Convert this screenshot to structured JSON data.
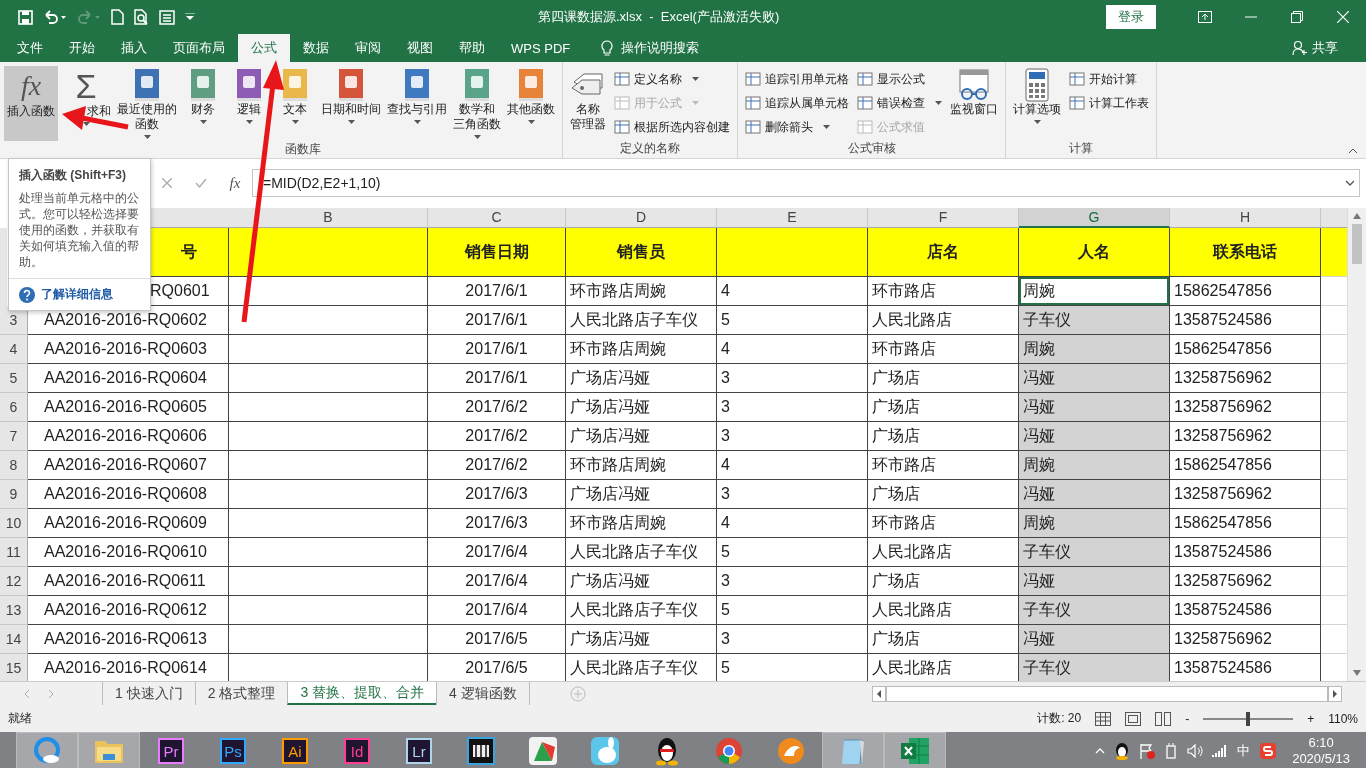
{
  "title_bar": {
    "quick_access": [
      {
        "kind": "save",
        "disabled": false
      },
      {
        "kind": "undo",
        "disabled": false
      },
      {
        "kind": "redo",
        "disabled": true
      },
      {
        "kind": "new",
        "disabled": false
      },
      {
        "kind": "preview",
        "disabled": false
      },
      {
        "kind": "form",
        "disabled": false
      },
      {
        "kind": "customize",
        "disabled": false
      }
    ],
    "title": "第四课数据源.xlsx  -  Excel(产品激活失败)",
    "login": "登录"
  },
  "tabs": [
    {
      "label": "文件",
      "selected": false
    },
    {
      "label": "开始",
      "selected": false
    },
    {
      "label": "插入",
      "selected": false
    },
    {
      "label": "页面布局",
      "selected": false
    },
    {
      "label": "公式",
      "selected": true
    },
    {
      "label": "数据",
      "selected": false
    },
    {
      "label": "审阅",
      "selected": false
    },
    {
      "label": "视图",
      "selected": false
    },
    {
      "label": "帮助",
      "selected": false
    },
    {
      "label": "WPS PDF",
      "selected": false
    }
  ],
  "tell_me": "操作说明搜索",
  "share": "共享",
  "ribbon": {
    "groups": [
      {
        "label": "函数库",
        "items": [
          {
            "kind": "fx",
            "icon_text": "fx",
            "lines": [
              "插入函数"
            ],
            "dropdown": false,
            "hovered": true,
            "partial": false
          },
          {
            "kind": "sigma",
            "icon_text": "Σ",
            "lines": [
              "求和"
            ],
            "dropdown": true,
            "hovered": false,
            "partial": true
          },
          {
            "kind": "book",
            "color": "#3d72b4",
            "lines": [
              "最近使用的",
              "函数"
            ],
            "dropdown": true,
            "hovered": false,
            "partial": false
          },
          {
            "kind": "book",
            "color": "#5f9e80",
            "lines": [
              "财务"
            ],
            "dropdown": true,
            "hovered": false,
            "partial": false
          },
          {
            "kind": "book",
            "color": "#8e5bb5",
            "lines": [
              "逻辑"
            ],
            "dropdown": true,
            "hovered": false,
            "partial": false
          },
          {
            "kind": "book",
            "color": "#eab84a",
            "lines": [
              "文本"
            ],
            "dropdown": true,
            "hovered": false,
            "partial": false
          },
          {
            "kind": "book",
            "color": "#d4553a",
            "lines": [
              "日期和时间"
            ],
            "dropdown": true,
            "hovered": false,
            "partial": false
          },
          {
            "kind": "book",
            "color": "#3f7ac0",
            "lines": [
              "查找与引用"
            ],
            "dropdown": true,
            "hovered": false,
            "partial": false
          },
          {
            "kind": "book",
            "color": "#5aa58a",
            "lines": [
              "数学和",
              "三角函数"
            ],
            "dropdown": true,
            "hovered": false,
            "partial": false
          },
          {
            "kind": "book",
            "color": "#e8833a",
            "lines": [
              "其他函数"
            ],
            "dropdown": true,
            "hovered": false,
            "partial": false
          }
        ]
      },
      {
        "label": "定义的名称",
        "items": [
          {
            "kind": "tags",
            "lines": [
              "名称",
              "管理器"
            ],
            "dropdown": false,
            "hovered": false,
            "partial": false
          },
          {
            "kind": "column",
            "items": [
              {
                "label": "定义名称",
                "dropdown": true,
                "disabled": false
              },
              {
                "label": "用于公式",
                "dropdown": true,
                "disabled": true
              },
              {
                "label": "根据所选内容创建",
                "dropdown": false,
                "disabled": false
              }
            ]
          }
        ]
      },
      {
        "label": "公式审核",
        "items": [
          {
            "kind": "column",
            "items": [
              {
                "label": "追踪引用单元格",
                "dropdown": false,
                "disabled": false
              },
              {
                "label": "追踪从属单元格",
                "dropdown": false,
                "disabled": false
              },
              {
                "label": "删除箭头",
                "dropdown": true,
                "disabled": false
              }
            ]
          },
          {
            "kind": "column",
            "items": [
              {
                "label": "显示公式",
                "dropdown": false,
                "disabled": false
              },
              {
                "label": "错误检查",
                "dropdown": true,
                "disabled": false
              },
              {
                "label": "公式求值",
                "dropdown": false,
                "disabled": true
              }
            ]
          },
          {
            "kind": "watch",
            "lines": [
              "监视窗口"
            ],
            "dropdown": false,
            "hovered": false,
            "partial": false
          }
        ]
      },
      {
        "label": "计算",
        "items": [
          {
            "kind": "calculator",
            "lines": [
              "计算选项"
            ],
            "dropdown": true,
            "hovered": false,
            "partial": false
          },
          {
            "kind": "column",
            "items": [
              {
                "label": "开始计算",
                "dropdown": false,
                "disabled": false
              },
              {
                "label": "计算工作表",
                "dropdown": false,
                "disabled": false
              }
            ]
          }
        ]
      }
    ]
  },
  "formula_bar": {
    "fx": "fx",
    "formula": "=MID(D2,E2+1,10)"
  },
  "tooltip": {
    "title": "插入函数 (Shift+F3)",
    "body": "处理当前单元格中的公式。您可以轻松选择要使用的函数，并获取有关如何填充输入值的帮助。",
    "link": "了解详细信息"
  },
  "grid": {
    "columns": [
      {
        "selected": false
      },
      {
        "label": "B",
        "selected": false
      },
      {
        "label": "C",
        "selected": false
      },
      {
        "label": "D",
        "selected": false
      },
      {
        "label": "E",
        "selected": false
      },
      {
        "label": "F",
        "selected": false
      },
      {
        "label": "G",
        "selected": true
      },
      {
        "label": "H",
        "selected": false
      }
    ],
    "rows": [
      {
        "kind": "header",
        "first_cell_partial": true,
        "has_active_cell": false,
        "cells": [
          "号",
          "",
          "销售日期",
          "销售员",
          "",
          "店名",
          "人名",
          "联系电话"
        ]
      },
      {
        "kind": "data",
        "first_cell_partial": true,
        "has_active_cell": true,
        "cells": [
          "RQ0601",
          "",
          "2017/6/1",
          "环市路店周婉",
          "4",
          "环市路店",
          "周婉",
          "15862547856"
        ]
      },
      {
        "kind": "data",
        "header": "3",
        "first_cell_partial": false,
        "has_active_cell": false,
        "cells": [
          "AA2016-2016-RQ0602",
          "",
          "2017/6/1",
          "人民北路店子车仪",
          "5",
          "人民北路店",
          "子车仪",
          "13587524586"
        ]
      },
      {
        "kind": "data",
        "header": "4",
        "first_cell_partial": false,
        "has_active_cell": false,
        "cells": [
          "AA2016-2016-RQ0603",
          "",
          "2017/6/1",
          "环市路店周婉",
          "4",
          "环市路店",
          "周婉",
          "15862547856"
        ]
      },
      {
        "kind": "data",
        "header": "5",
        "first_cell_partial": false,
        "has_active_cell": false,
        "cells": [
          "AA2016-2016-RQ0604",
          "",
          "2017/6/1",
          "广场店冯娅",
          "3",
          "广场店",
          "冯娅",
          "13258756962"
        ]
      },
      {
        "kind": "data",
        "header": "6",
        "first_cell_partial": false,
        "has_active_cell": false,
        "cells": [
          "AA2016-2016-RQ0605",
          "",
          "2017/6/2",
          "广场店冯娅",
          "3",
          "广场店",
          "冯娅",
          "13258756962"
        ]
      },
      {
        "kind": "data",
        "header": "7",
        "first_cell_partial": false,
        "has_active_cell": false,
        "cells": [
          "AA2016-2016-RQ0606",
          "",
          "2017/6/2",
          "广场店冯娅",
          "3",
          "广场店",
          "冯娅",
          "13258756962"
        ]
      },
      {
        "kind": "data",
        "header": "8",
        "first_cell_partial": false,
        "has_active_cell": false,
        "cells": [
          "AA2016-2016-RQ0607",
          "",
          "2017/6/2",
          "环市路店周婉",
          "4",
          "环市路店",
          "周婉",
          "15862547856"
        ]
      },
      {
        "kind": "data",
        "header": "9",
        "first_cell_partial": false,
        "has_active_cell": false,
        "cells": [
          "AA2016-2016-RQ0608",
          "",
          "2017/6/3",
          "广场店冯娅",
          "3",
          "广场店",
          "冯娅",
          "13258756962"
        ]
      },
      {
        "kind": "data",
        "header": "10",
        "first_cell_partial": false,
        "has_active_cell": false,
        "cells": [
          "AA2016-2016-RQ0609",
          "",
          "2017/6/3",
          "环市路店周婉",
          "4",
          "环市路店",
          "周婉",
          "15862547856"
        ]
      },
      {
        "kind": "data",
        "header": "11",
        "first_cell_partial": false,
        "has_active_cell": false,
        "cells": [
          "AA2016-2016-RQ0610",
          "",
          "2017/6/4",
          "人民北路店子车仪",
          "5",
          "人民北路店",
          "子车仪",
          "13587524586"
        ]
      },
      {
        "kind": "data",
        "header": "12",
        "first_cell_partial": false,
        "has_active_cell": false,
        "cells": [
          "AA2016-2016-RQ0611",
          "",
          "2017/6/4",
          "广场店冯娅",
          "3",
          "广场店",
          "冯娅",
          "13258756962"
        ]
      },
      {
        "kind": "data",
        "header": "13",
        "first_cell_partial": false,
        "has_active_cell": false,
        "cells": [
          "AA2016-2016-RQ0612",
          "",
          "2017/6/4",
          "人民北路店子车仪",
          "5",
          "人民北路店",
          "子车仪",
          "13587524586"
        ]
      },
      {
        "kind": "data",
        "header": "14",
        "first_cell_partial": false,
        "has_active_cell": false,
        "cells": [
          "AA2016-2016-RQ0613",
          "",
          "2017/6/5",
          "广场店冯娅",
          "3",
          "广场店",
          "冯娅",
          "13258756962"
        ]
      },
      {
        "kind": "data",
        "header": "15",
        "first_cell_partial": false,
        "has_active_cell": false,
        "cells": [
          "AA2016-2016-RQ0614",
          "",
          "2017/6/5",
          "人民北路店子车仪",
          "5",
          "人民北路店",
          "子车仪",
          "13587524586"
        ]
      }
    ]
  },
  "sheet_tabs": [
    {
      "label": "1 快速入门",
      "selected": false
    },
    {
      "label": "2 格式整理",
      "selected": false
    },
    {
      "label": "3 替换、提取、合并",
      "selected": true
    },
    {
      "label": "4 逻辑函数",
      "selected": false
    }
  ],
  "status_bar": {
    "status": "就绪",
    "count": "计数: 20",
    "zoom_out": "-",
    "zoom_in": "+",
    "zoom": {
      "level": 0.5
    },
    "zoom_text": "110%"
  },
  "taskbar": {
    "apps": [
      {
        "kind": "browser",
        "active": true
      },
      {
        "kind": "folder",
        "active": true
      },
      {
        "kind": "letter",
        "label": "Pr",
        "color": "#e77cff",
        "active": false
      },
      {
        "kind": "letter",
        "label": "Ps",
        "color": "#31a8ff",
        "active": false
      },
      {
        "kind": "letter",
        "label": "Ai",
        "color": "#ff9a00",
        "active": false
      },
      {
        "kind": "letter",
        "label": "Id",
        "color": "#ff3f94",
        "active": false
      },
      {
        "kind": "letter",
        "label": "Lr",
        "color": "#add5ec",
        "active": false
      },
      {
        "kind": "film",
        "active": false
      },
      {
        "kind": "chart",
        "active": false
      },
      {
        "kind": "rabbit",
        "active": false
      },
      {
        "kind": "penguin",
        "active": false
      },
      {
        "kind": "globe",
        "active": false
      },
      {
        "kind": "fox",
        "active": false
      },
      {
        "kind": "notepad",
        "active": true
      },
      {
        "kind": "sheet",
        "active": true
      }
    ],
    "ime": "中",
    "time": "6:10",
    "date": "2020/5/13"
  }
}
